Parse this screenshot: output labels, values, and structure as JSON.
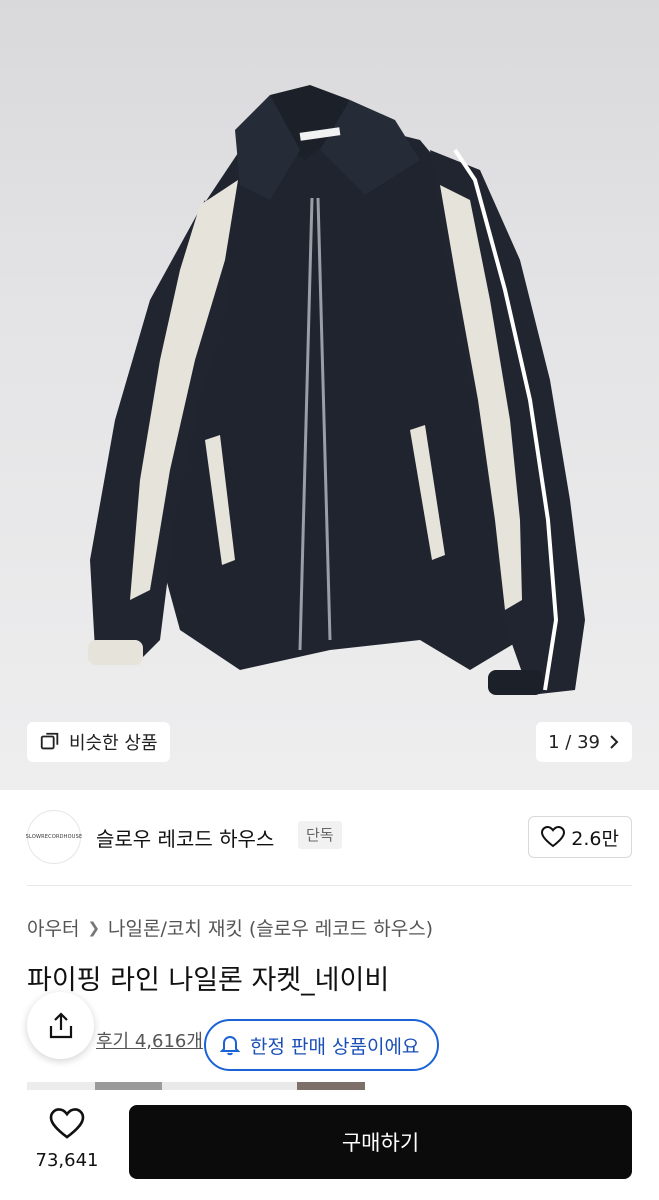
{
  "hero": {
    "similar_label": "비슷한 상품",
    "counter": "1 / 39"
  },
  "brand": {
    "logo_text": "SLOWRECORDHOUSE",
    "name": "슬로우 레코드 하우스",
    "badge": "단독",
    "likes": "2.6만"
  },
  "product": {
    "breadcrumb": [
      "아우터",
      "나일론/코치 재킷 (슬로우 레코드 하우스)"
    ],
    "title": "파이핑 라인 나일론 자켓_네이비",
    "review": "후기 4,616개",
    "notice": "한정 판매 상품이에요"
  },
  "bottom": {
    "wish_count": "73,641",
    "buy_label": "구매하기"
  },
  "colors": {
    "jacket_navy": "#1f242e",
    "panel_cream": "#e6e3db",
    "accent_blue": "#1a63d6",
    "button_black": "#0b0b0b"
  }
}
